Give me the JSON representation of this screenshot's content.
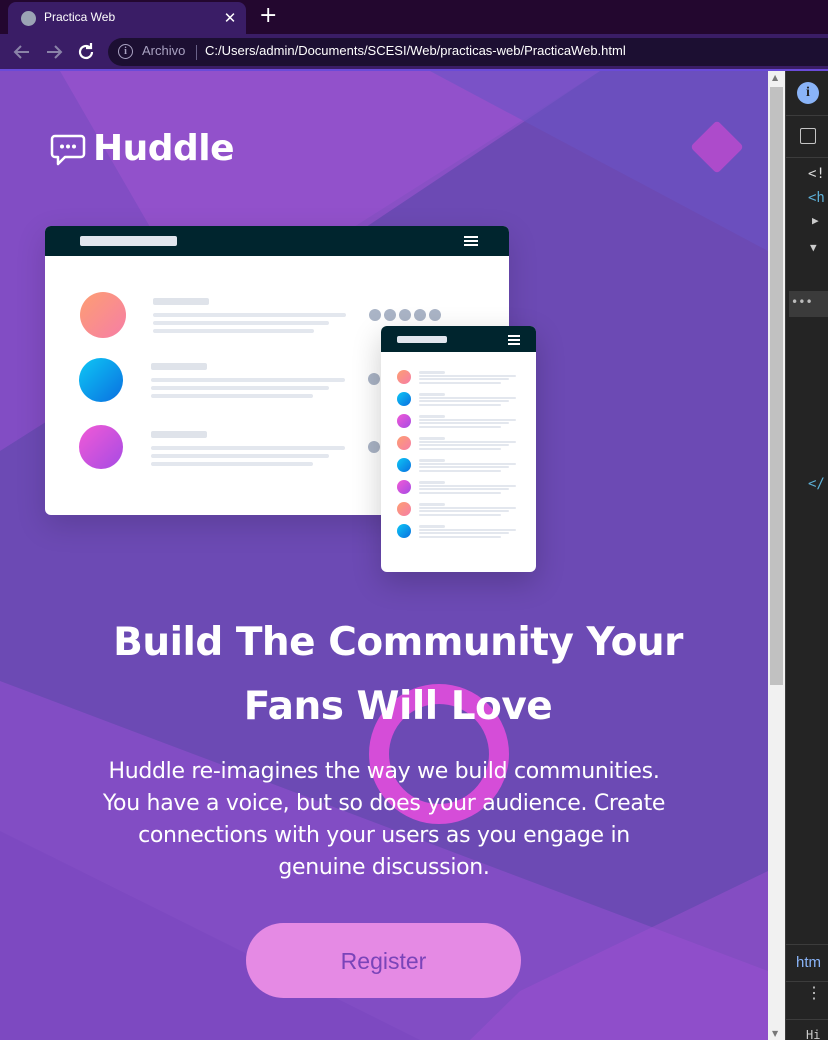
{
  "browser": {
    "tab_title": "Practica Web",
    "tab_close": "✕",
    "new_tab": "+",
    "origin_label": "Archivo",
    "url": "C:/Users/admin/Documents/SCESI/Web/practicas-web/PracticaWeb.html"
  },
  "page": {
    "brand_name": "Huddle",
    "headline_line1": "Build The Community Your",
    "headline_line2": "Fans Will Love",
    "lead_line1": "Huddle re-imagines the way we build communities.",
    "lead_line2": "You have a voice, but so does your audience. Create",
    "lead_line3": "connections with your users as you engage in",
    "lead_line4": "genuine discussion.",
    "register_label": "Register",
    "colors": {
      "background": "#6c4ab4",
      "accent_pink": "#e58ae4",
      "button_text": "#7a44b9",
      "mock_header": "#00252e"
    }
  },
  "devtools": {
    "info": "i",
    "code_lines": [
      "<!",
      "<h",
      "▶",
      "▼",
      "",
      "",
      "",
      "",
      "",
      "",
      "",
      "</"
    ],
    "hl_dots": "•••",
    "panel_tab": "htm",
    "kebab": "⋮",
    "bottom_text": "Hi"
  },
  "icons": {
    "favicon": "globe-icon",
    "back": "arrow-left-icon",
    "forward": "arrow-right-icon",
    "reload": "reload-icon",
    "info": "info-icon",
    "brand": "chat-bubble-icon"
  }
}
